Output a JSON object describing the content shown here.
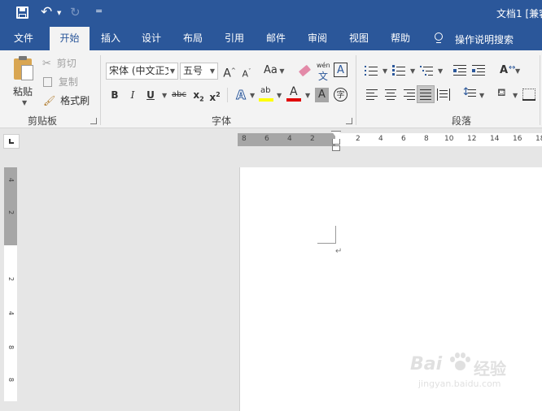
{
  "title": {
    "doc_title": "文档1 [兼容"
  },
  "quick_access": {
    "more": "="
  },
  "tabs": [
    "文件",
    "开始",
    "插入",
    "设计",
    "布局",
    "引用",
    "邮件",
    "审阅",
    "视图",
    "帮助"
  ],
  "tell_me": "操作说明搜索",
  "clipboard": {
    "paste": "粘贴",
    "cut": "剪切",
    "copy": "复制",
    "format_painter": "格式刷",
    "group": "剪贴板"
  },
  "font": {
    "name": "宋体 (中文正文",
    "size": "五号",
    "change_case": "Aa",
    "phonetic_top": "wén",
    "phonetic_bottom": "文",
    "border_char": "A",
    "group": "字体",
    "enclose": "字"
  },
  "paragraph": {
    "group": "段落"
  },
  "hruler": {
    "left_ticks": [
      "8",
      "6",
      "4",
      "2"
    ],
    "right_ticks": [
      "2",
      "4",
      "6",
      "8",
      "10",
      "12",
      "14",
      "16",
      "18"
    ]
  },
  "vruler": {
    "ticks": [
      "4",
      "2",
      "2",
      "4",
      "8",
      "8"
    ]
  },
  "doc": {
    "para_mark": "↵"
  },
  "watermark": {
    "brand": "Bai",
    "brand_cn": "经验",
    "url": "jingyan.baidu.com"
  },
  "colors": {
    "accent": "#2b579a",
    "highlight": "#ffff00",
    "font_color": "#e00000"
  }
}
